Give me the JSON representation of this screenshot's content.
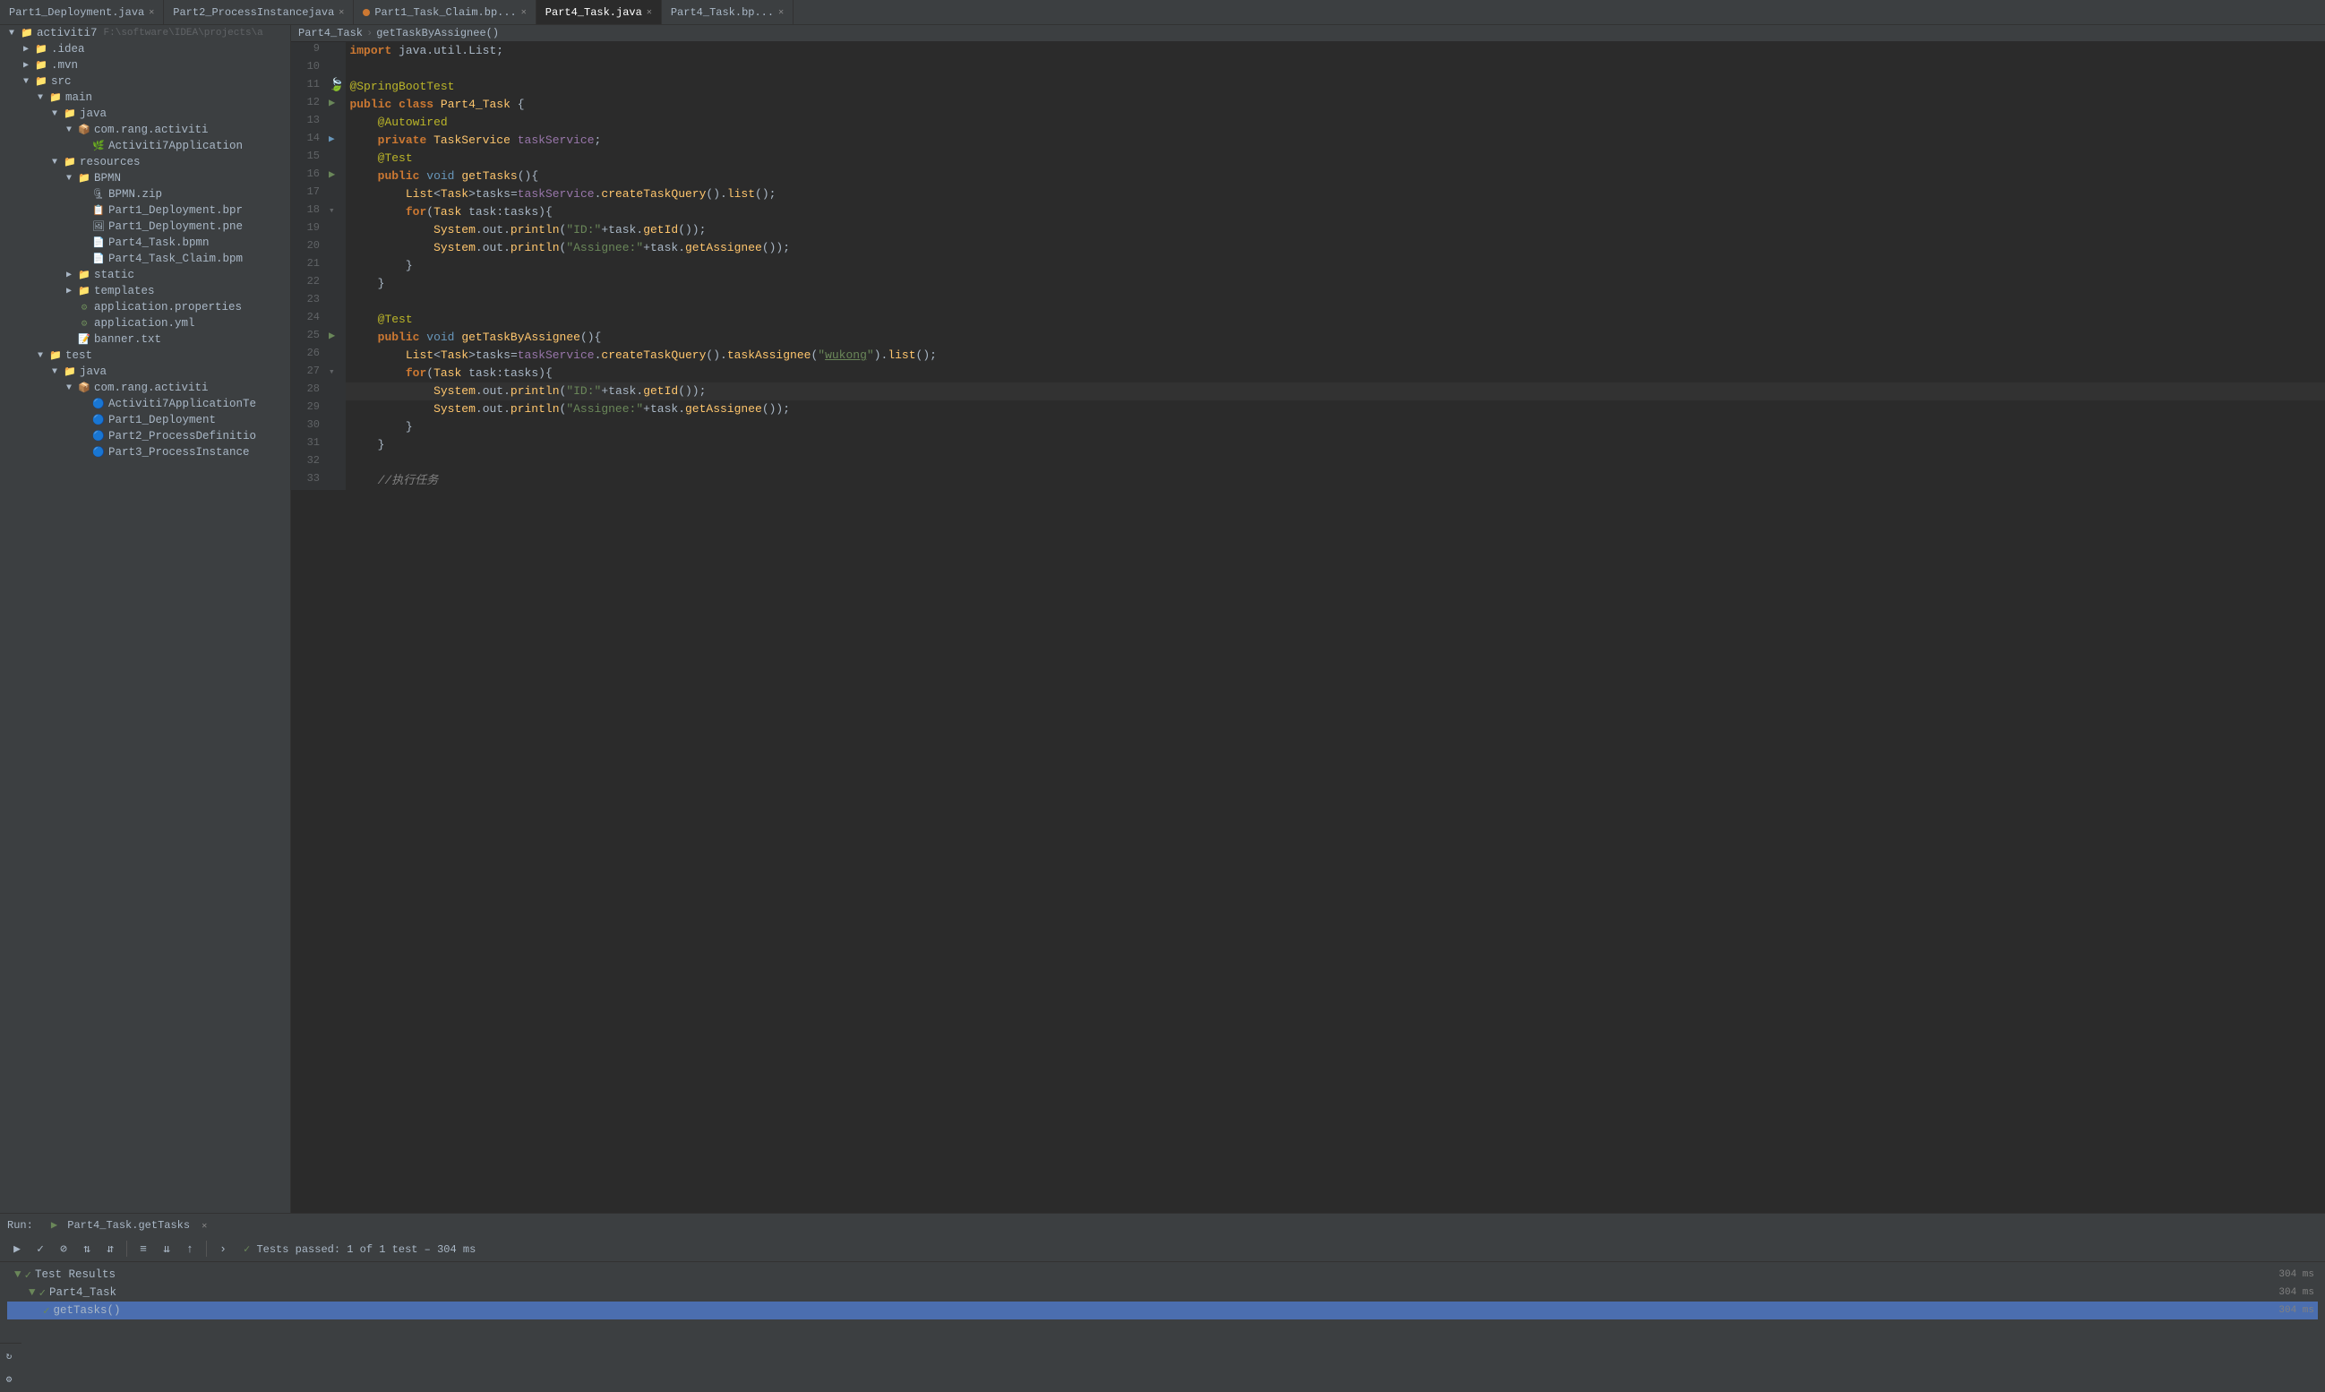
{
  "tabs": [
    {
      "id": "t1",
      "label": "Part1_Deployment.java",
      "color": "none",
      "active": false,
      "dot": false
    },
    {
      "id": "t2",
      "label": "Part2_ProcessInstancejava",
      "color": "none",
      "active": false,
      "dot": false
    },
    {
      "id": "t3",
      "label": "Part1_Task_Claim.bp...",
      "color": "red",
      "active": false,
      "dot": false
    },
    {
      "id": "t4",
      "label": "Part4_Task.java",
      "color": "blue",
      "active": true,
      "dot": false
    },
    {
      "id": "t5",
      "label": "Part4_Task.bp...",
      "color": "none",
      "active": false,
      "dot": false
    }
  ],
  "filetree": {
    "project_label": "activiti7",
    "project_path": "F:\\software\\IDEA\\projects\\a"
  },
  "editor": {
    "lines": [
      {
        "num": 9,
        "gutter": "",
        "code": "import java.util.List;",
        "type": "import"
      },
      {
        "num": 10,
        "gutter": "",
        "code": "",
        "type": "empty"
      },
      {
        "num": 11,
        "gutter": "leaf",
        "code": "@SpringBootTest",
        "type": "annotation"
      },
      {
        "num": 12,
        "gutter": "run",
        "code": "public class Part4_Task {",
        "type": "class"
      },
      {
        "num": 13,
        "gutter": "",
        "code": "    @Autowired",
        "type": "annotation"
      },
      {
        "num": 14,
        "gutter": "run2",
        "code": "    private TaskService taskService;",
        "type": "field"
      },
      {
        "num": 15,
        "gutter": "",
        "code": "    @Test",
        "type": "annotation"
      },
      {
        "num": 16,
        "gutter": "run",
        "code": "    public void getTasks(){",
        "type": "method"
      },
      {
        "num": 17,
        "gutter": "",
        "code": "        List<Task>tasks=taskService.createTaskQuery().list();",
        "type": "code"
      },
      {
        "num": 18,
        "gutter": "fold",
        "code": "        for(Task task:tasks){",
        "type": "code"
      },
      {
        "num": 19,
        "gutter": "",
        "code": "            System.out.println(\"ID:\"+task.getId());",
        "type": "code"
      },
      {
        "num": 20,
        "gutter": "",
        "code": "            System.out.println(\"Assignee:\"+task.getAssignee());",
        "type": "code"
      },
      {
        "num": 21,
        "gutter": "",
        "code": "        }",
        "type": "code"
      },
      {
        "num": 22,
        "gutter": "",
        "code": "    }",
        "type": "code"
      },
      {
        "num": 23,
        "gutter": "",
        "code": "",
        "type": "empty"
      },
      {
        "num": 24,
        "gutter": "",
        "code": "    @Test",
        "type": "annotation"
      },
      {
        "num": 25,
        "gutter": "run",
        "code": "    public void getTaskByAssignee(){",
        "type": "method"
      },
      {
        "num": 26,
        "gutter": "",
        "code": "        List<Task>tasks=taskService.createTaskQuery().taskAssignee(\"wukong\").list();",
        "type": "code"
      },
      {
        "num": 27,
        "gutter": "fold",
        "code": "        for(Task task:tasks){",
        "type": "code"
      },
      {
        "num": 28,
        "gutter": "",
        "code": "            System.out.println(\"ID:\"+task.getId());",
        "type": "code"
      },
      {
        "num": 29,
        "gutter": "",
        "code": "            System.out.println(\"Assignee:\"+task.getAssignee());",
        "type": "code"
      },
      {
        "num": 30,
        "gutter": "",
        "code": "        }",
        "type": "code"
      },
      {
        "num": 31,
        "gutter": "",
        "code": "    }",
        "type": "code"
      },
      {
        "num": 32,
        "gutter": "",
        "code": "",
        "type": "empty"
      },
      {
        "num": 33,
        "gutter": "",
        "code": "    //执行任务",
        "type": "comment"
      }
    ]
  },
  "breadcrumb": {
    "class": "Part4_Task",
    "method": "getTaskByAssignee()"
  },
  "bottom": {
    "run_tab": "Part4_Task.getTasks",
    "status": "Tests passed: 1 of 1 test – 304 ms",
    "test_results": [
      {
        "label": "Test Results",
        "time": "304 ms",
        "level": 0
      },
      {
        "label": "Part4_Task",
        "time": "304 ms",
        "level": 1
      },
      {
        "label": "getTasks()",
        "time": "304 ms",
        "level": 2,
        "selected": true
      }
    ]
  }
}
